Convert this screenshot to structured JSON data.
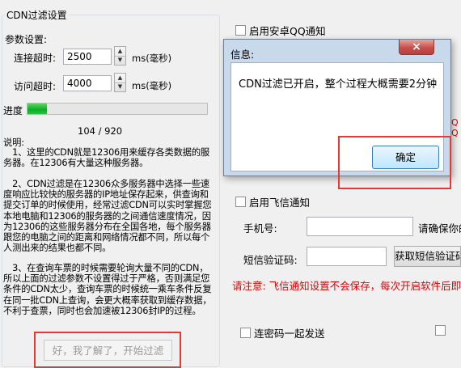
{
  "cdn_settings": {
    "group_title": "CDN过滤设置",
    "params_label": "参数设置:",
    "connect_timeout_label": "连接超时:",
    "connect_timeout_value": "2500",
    "connect_timeout_unit": "ms(毫秒)",
    "access_timeout_label": "访问超时:",
    "access_timeout_value": "4000",
    "access_timeout_unit": "ms(毫秒)",
    "progress_label": "进度",
    "progress_fraction": 0.11,
    "progress_text": "104 / 920",
    "explain_title": "说明:",
    "explain_1": "　1、这里的CDN就是12306用来缓存各类数据的服务器。在12306有大量这种服务器。",
    "explain_2": "　2、CDN过滤是在12306众多服务器中选择一些速度响应比较快的服务器的IP地址保存起来，供查询和提交订单的时候使用，经常过滤CDN可以实时掌握您本地电脑和12306的服务器的之间通信速度情况，因为12306的这些服务器分布在全国各地，每个服务器跟您的电脑之间的距离和网络情况都不同，所以每个人测出来的结果也都不同。",
    "explain_3": "　3、在查询车票的时候需要轮询大量不同的CDN，所以上面的过滤参数不设置得过于严格，否则满足您条件的CDN太少，查询车票的时候统一乘车条件反复在同一批CDN上查询，会更大概率获取到缓存数据，不利于查票，同时也会加速被12306封IP的过程。",
    "start_button_label": "好，我了解了，开始过滤"
  },
  "right_panel": {
    "android_qq_label": "启用安卓QQ通知",
    "feixin_label": "启用飞信通知",
    "phone_label": "手机号:",
    "phone_note": "请确保你的",
    "sms_code_label": "短信验证码:",
    "get_code_button": "获取短信验证码",
    "warning_text": "请注意: 飞信通知设置不会保存，每次开启软件后即失效",
    "combo_send_label": "连密码一起发送",
    "partial_side_text": "Q\nQ"
  },
  "dialog": {
    "title": "信息:",
    "close_symbol": "×",
    "message": "CDN过滤已开启，整个过程大概需要2分钟",
    "ok_label": "确定"
  },
  "colors": {
    "highlight_red": "#e53935",
    "progress_green": "#06b025",
    "warning_red": "#e00000"
  }
}
